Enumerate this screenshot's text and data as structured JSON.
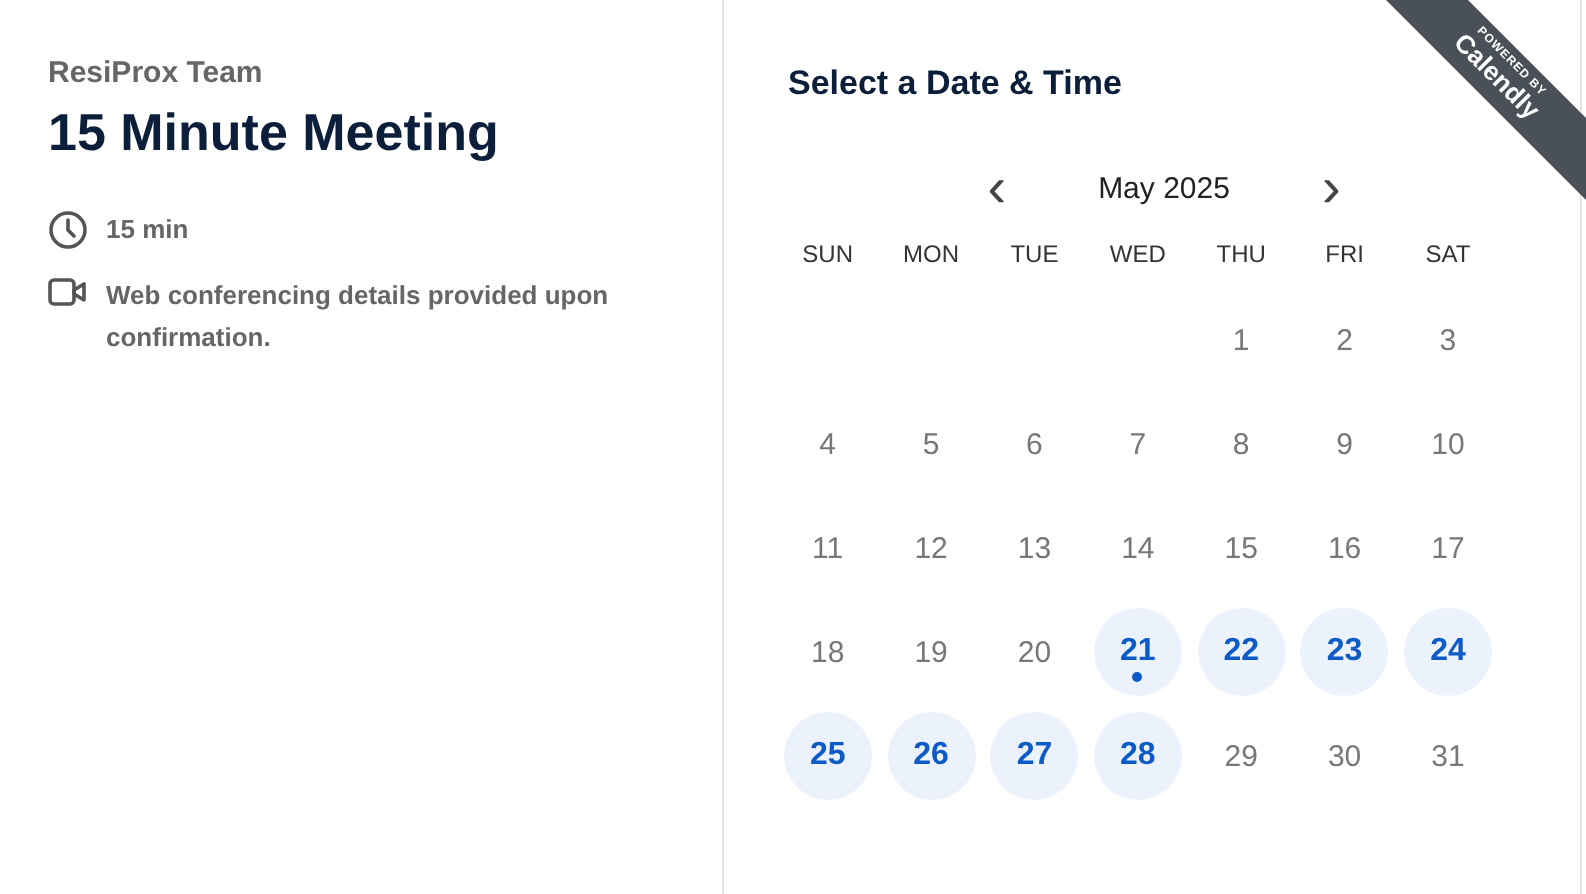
{
  "event": {
    "organizer": "ResiProx Team",
    "title": "15 Minute Meeting",
    "details": [
      {
        "kind": "duration",
        "text": "15 min"
      },
      {
        "kind": "video",
        "text": "Web conferencing details provided upon confirmation."
      }
    ]
  },
  "calendar": {
    "heading": "Select a Date & Time",
    "prev": "‹",
    "month": "May 2025",
    "next": "›",
    "weekdays": [
      "SUN",
      "MON",
      "TUE",
      "WED",
      "THU",
      "FRI",
      "SAT"
    ],
    "weeks": [
      [
        {
          "kind": "blank"
        },
        {
          "kind": "blank"
        },
        {
          "kind": "blank"
        },
        {
          "kind": "blank"
        },
        {
          "kind": "day",
          "label": "1",
          "available": false,
          "today": false
        },
        {
          "kind": "day",
          "label": "2",
          "available": false,
          "today": false
        },
        {
          "kind": "day",
          "label": "3",
          "available": false,
          "today": false
        }
      ],
      [
        {
          "kind": "day",
          "label": "4",
          "available": false,
          "today": false
        },
        {
          "kind": "day",
          "label": "5",
          "available": false,
          "today": false
        },
        {
          "kind": "day",
          "label": "6",
          "available": false,
          "today": false
        },
        {
          "kind": "day",
          "label": "7",
          "available": false,
          "today": false
        },
        {
          "kind": "day",
          "label": "8",
          "available": false,
          "today": false
        },
        {
          "kind": "day",
          "label": "9",
          "available": false,
          "today": false
        },
        {
          "kind": "day",
          "label": "10",
          "available": false,
          "today": false
        }
      ],
      [
        {
          "kind": "day",
          "label": "11",
          "available": false,
          "today": false
        },
        {
          "kind": "day",
          "label": "12",
          "available": false,
          "today": false
        },
        {
          "kind": "day",
          "label": "13",
          "available": false,
          "today": false
        },
        {
          "kind": "day",
          "label": "14",
          "available": false,
          "today": false
        },
        {
          "kind": "day",
          "label": "15",
          "available": false,
          "today": false
        },
        {
          "kind": "day",
          "label": "16",
          "available": false,
          "today": false
        },
        {
          "kind": "day",
          "label": "17",
          "available": false,
          "today": false
        }
      ],
      [
        {
          "kind": "day",
          "label": "18",
          "available": false,
          "today": false
        },
        {
          "kind": "day",
          "label": "19",
          "available": false,
          "today": false
        },
        {
          "kind": "day",
          "label": "20",
          "available": false,
          "today": false
        },
        {
          "kind": "day",
          "label": "21",
          "available": true,
          "today": true
        },
        {
          "kind": "day",
          "label": "22",
          "available": true,
          "today": false
        },
        {
          "kind": "day",
          "label": "23",
          "available": true,
          "today": false
        },
        {
          "kind": "day",
          "label": "24",
          "available": true,
          "today": false
        }
      ],
      [
        {
          "kind": "day",
          "label": "25",
          "available": true,
          "today": false
        },
        {
          "kind": "day",
          "label": "26",
          "available": true,
          "today": false
        },
        {
          "kind": "day",
          "label": "27",
          "available": true,
          "today": false
        },
        {
          "kind": "day",
          "label": "28",
          "available": true,
          "today": false
        },
        {
          "kind": "day",
          "label": "29",
          "available": false,
          "today": false
        },
        {
          "kind": "day",
          "label": "30",
          "available": false,
          "today": false
        },
        {
          "kind": "day",
          "label": "31",
          "available": false,
          "today": false
        }
      ]
    ]
  },
  "badge": {
    "caption": "POWERED BY",
    "brand": "Calendly"
  }
}
